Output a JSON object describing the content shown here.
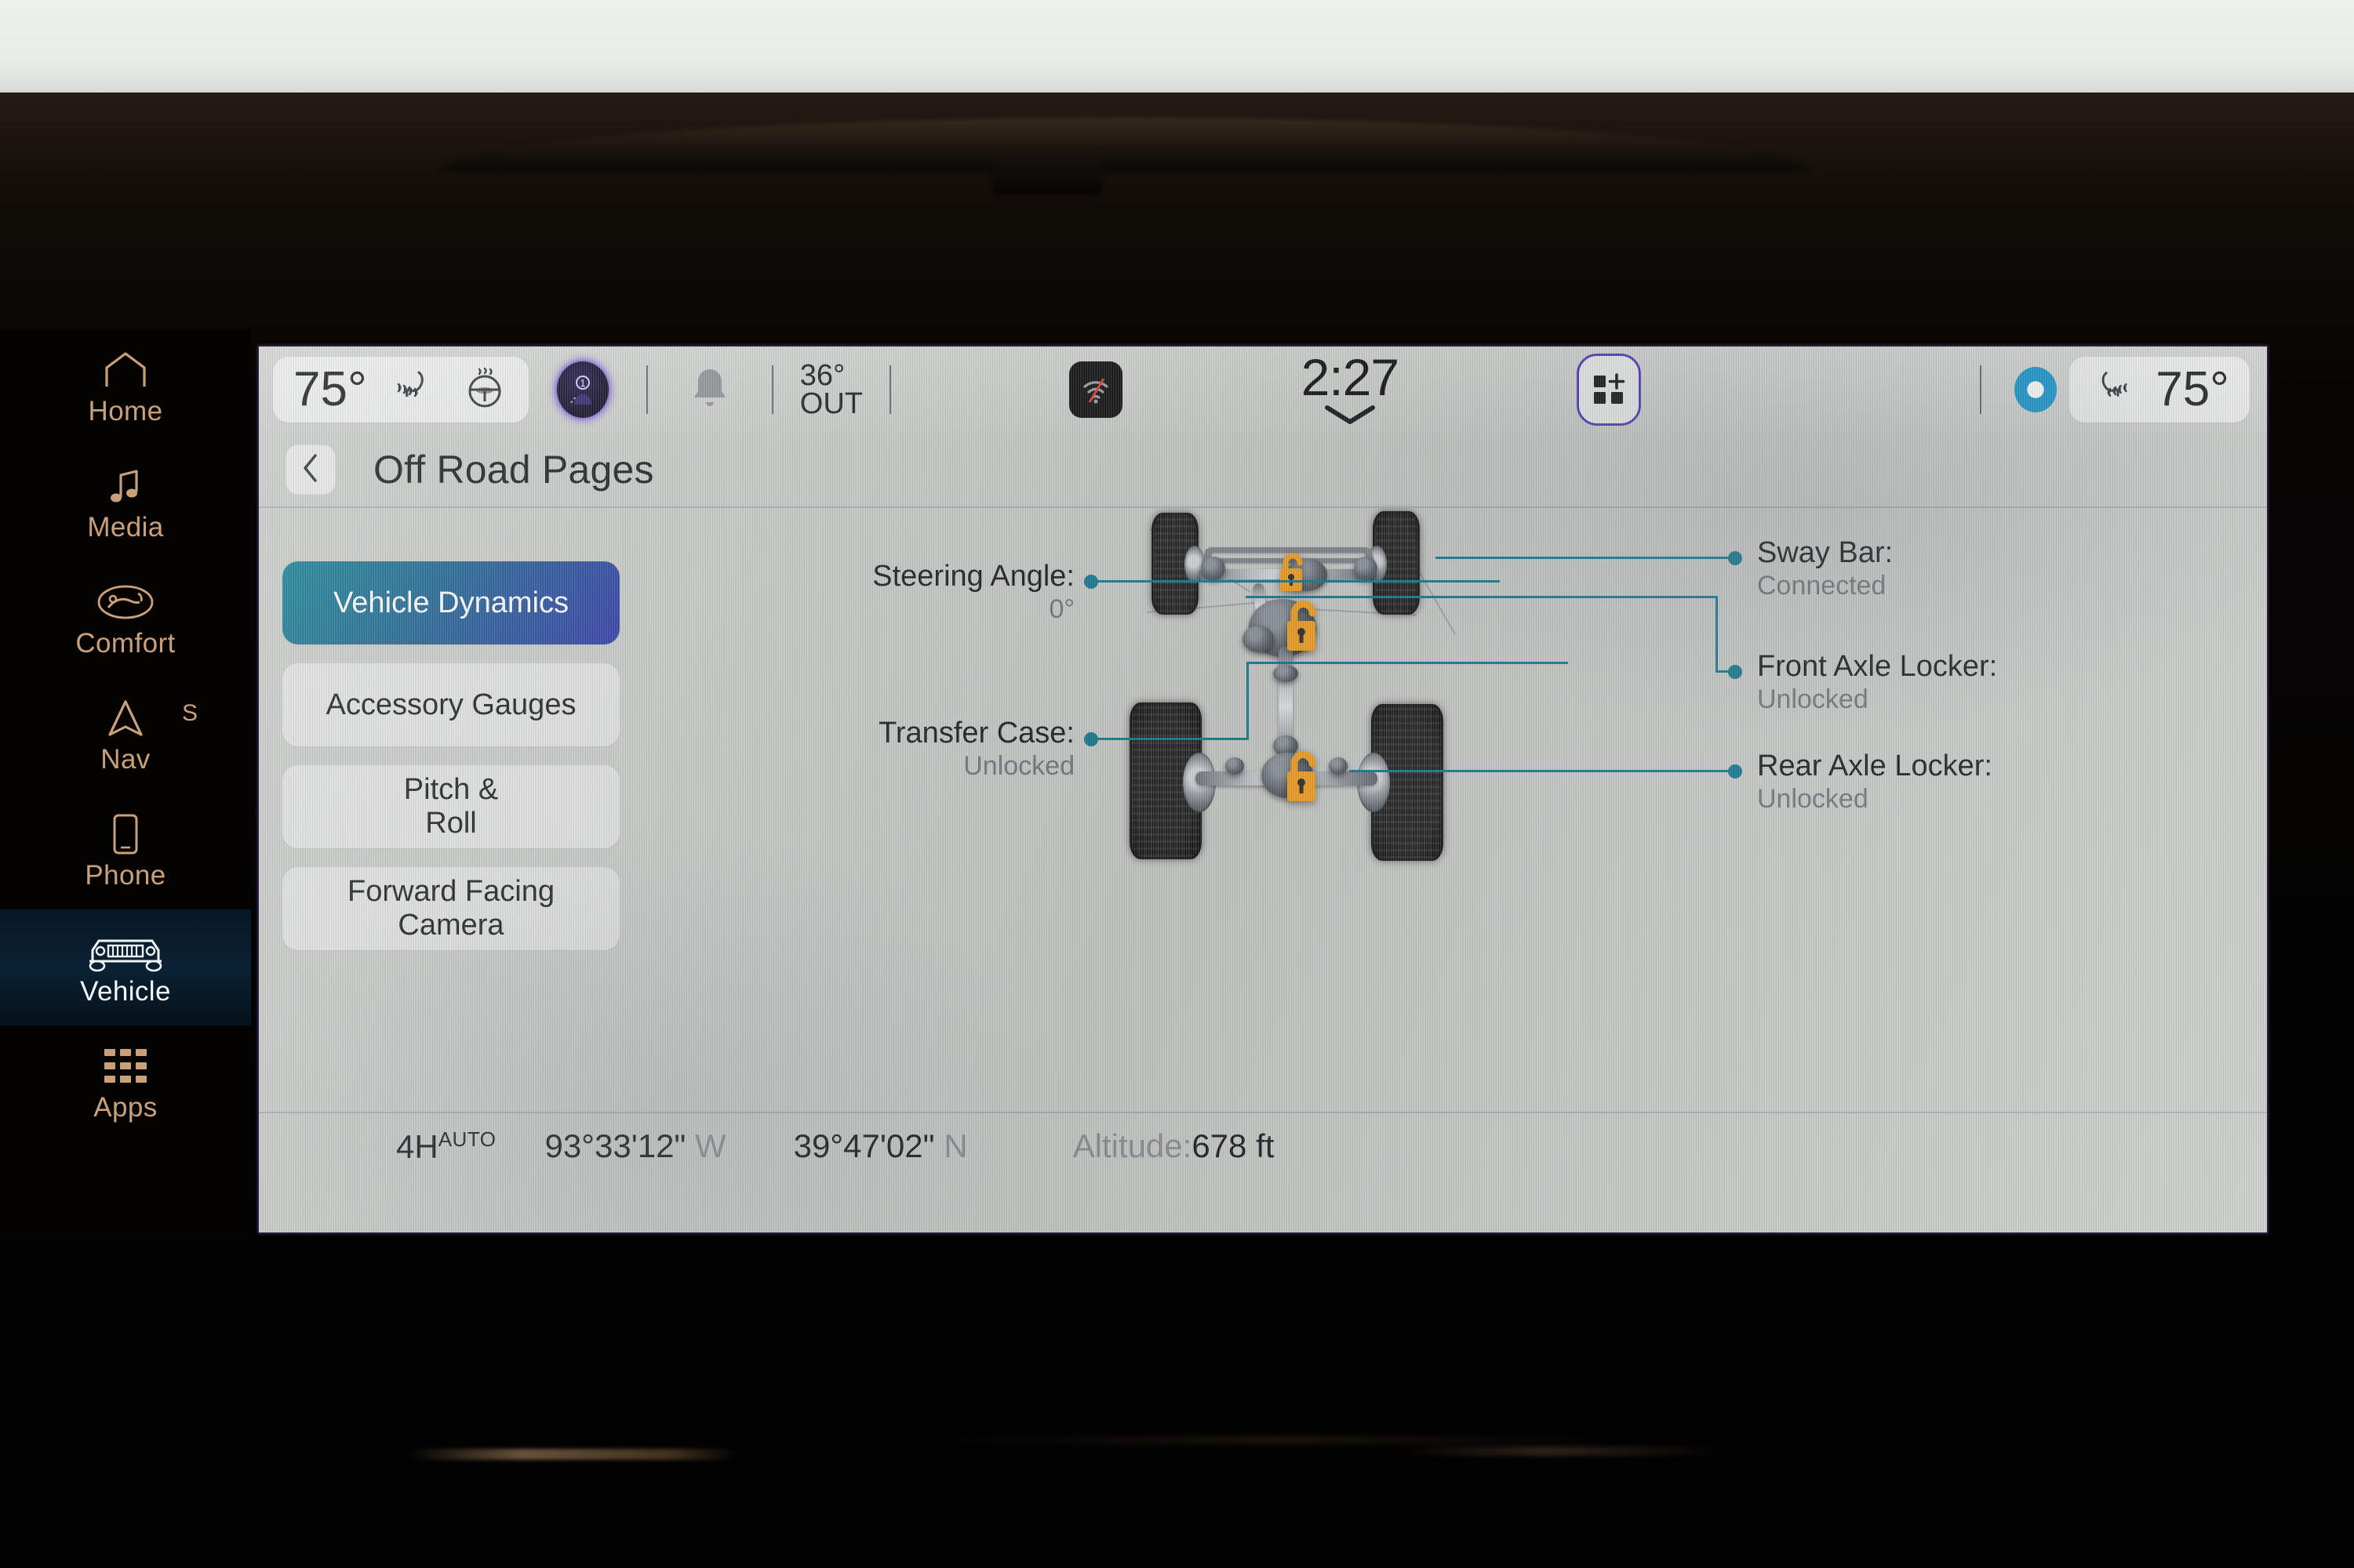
{
  "sidebar": {
    "items": [
      {
        "label": "Home",
        "icon": "home-icon",
        "active": false,
        "badge": ""
      },
      {
        "label": "Media",
        "icon": "music-note-icon",
        "active": false,
        "badge": ""
      },
      {
        "label": "Comfort",
        "icon": "seat-comfort-icon",
        "active": false,
        "badge": ""
      },
      {
        "label": "Nav",
        "icon": "navigation-arrow-icon",
        "active": false,
        "badge": "S"
      },
      {
        "label": "Phone",
        "icon": "phone-icon",
        "active": false,
        "badge": ""
      },
      {
        "label": "Vehicle",
        "icon": "jeep-front-icon",
        "active": true,
        "badge": ""
      },
      {
        "label": "Apps",
        "icon": "grid-apps-icon",
        "active": false,
        "badge": ""
      }
    ]
  },
  "statusbar": {
    "driver_temp": "75°",
    "heated_seat_icon": "heated-seat-icon",
    "heated_wheel_icon": "heated-steering-wheel-icon",
    "profile_icon": "driver-profile-1-icon",
    "profile_number": "1",
    "notification_icon": "bell-icon",
    "outside_temp": "36°",
    "outside_label": "OUT",
    "connectivity_icon": "wifi-off-icon",
    "clock": "2:27",
    "clock_chevron_icon": "chevron-down-icon",
    "widget_icon": "add-widget-icon",
    "assistant_icon": "alexa-icon",
    "passenger_seat_icon": "heated-seat-icon",
    "passenger_temp": "75°"
  },
  "header": {
    "back_icon": "chevron-left-icon",
    "title": "Off Road Pages"
  },
  "menu": {
    "buttons": [
      {
        "label": "Vehicle Dynamics",
        "selected": true
      },
      {
        "label": "Accessory Gauges",
        "selected": false
      },
      {
        "label": "Pitch &\nRoll",
        "selected": false
      },
      {
        "label": "Forward Facing\nCamera",
        "selected": false
      }
    ]
  },
  "readouts": {
    "left": [
      {
        "label": "Steering Angle:",
        "value": "0°"
      },
      {
        "label": "Transfer Case:",
        "value": "Unlocked"
      }
    ],
    "right": [
      {
        "label": "Sway Bar:",
        "value": "Connected"
      },
      {
        "label": "Front Axle Locker:",
        "value": "Unlocked"
      },
      {
        "label": "Rear Axle Locker:",
        "value": "Unlocked"
      }
    ]
  },
  "diagram": {
    "locks": [
      {
        "name": "front-axle-lock-icon",
        "state": "unlocked"
      },
      {
        "name": "transfer-case-lock-icon",
        "state": "unlocked"
      },
      {
        "name": "rear-axle-lock-icon",
        "state": "unlocked"
      }
    ]
  },
  "bottombar": {
    "drive_mode": "4H",
    "drive_mode_sup": "AUTO",
    "longitude": "93°33'12\"",
    "longitude_dir": "W",
    "latitude": "39°47'02\"",
    "latitude_dir": "N",
    "altitude_label": "Altitude:",
    "altitude_value": "678 ft"
  },
  "colors": {
    "accent_teal": "#11788f",
    "lock_orange": "#f5a01e",
    "active_gradient_start": "#0f8090",
    "active_gradient_end": "#2b35a6",
    "sidebar_gold": "#c9a077",
    "alexa_blue": "#0f93cc"
  }
}
